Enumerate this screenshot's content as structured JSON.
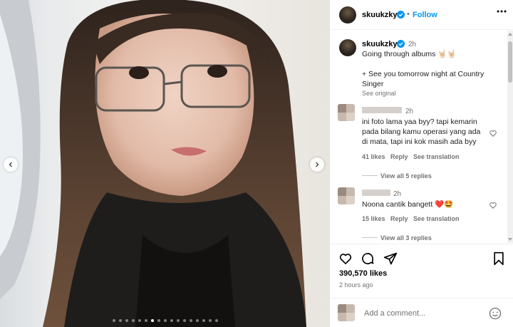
{
  "post": {
    "username": "skuukzky",
    "follow_label": "Follow",
    "caption_username": "skuukzky",
    "caption_time": "2h",
    "caption_line1": "Going through albums 🤘🏻🤘🏻",
    "caption_line2": "+ See you tomorrow night at Country",
    "caption_line3": "Singer",
    "see_original": "See original",
    "likes": "390,570 likes",
    "posted": "2 hours ago",
    "carousel_total": 17,
    "carousel_active": 6
  },
  "comments": [
    {
      "time": "2h",
      "lines": [
        "ini foto lama yaa byy? tapi kemarin",
        "pada bilang kamu operasi yang ada",
        "di mata, tapi ini kok masih ada byy"
      ],
      "likes": "41 likes",
      "reply": "Reply",
      "translate": "See translation",
      "view_replies": "View all 5 replies"
    },
    {
      "time": "2h",
      "lines": [
        "Noona cantik bangett ❤️🤩"
      ],
      "likes": "15 likes",
      "reply": "Reply",
      "translate": "See translation",
      "view_replies": "View all 3 replies"
    }
  ],
  "add_comment": {
    "placeholder": "Add a comment..."
  },
  "icons": {
    "like": "heart-icon",
    "comment": "comment-icon",
    "share": "paper-plane-icon",
    "save": "bookmark-icon",
    "emoji": "smiley-icon",
    "more": "more-options-icon",
    "verified": "verified-badge-icon"
  },
  "colors": {
    "follow": "#0095f6",
    "verified": "#0095f6",
    "muted": "#737373"
  }
}
